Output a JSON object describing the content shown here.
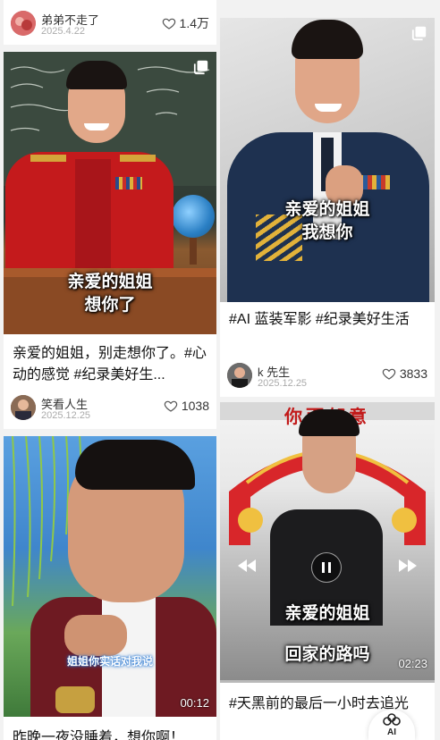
{
  "cards": [
    {
      "username": "弟弟不走了",
      "date": "2025.4.22",
      "likes": "1.4万"
    },
    {
      "subtitle_line1": "亲爱的姐姐",
      "subtitle_line2": "想你了",
      "caption": "亲爱的姐姐，别走想你了。#心动的感觉 #纪录美好生...",
      "username": "笑看人生",
      "date": "2025.12.25",
      "likes": "1038"
    },
    {
      "subtitle_line1": "亲爱的姐姐",
      "subtitle_line2": "我想你",
      "caption": "#AI 蓝装军影 #纪录美好生活",
      "username": "k 先生",
      "date": "2025.12.25",
      "likes": "3833"
    },
    {
      "subtitle": "姐姐你实话对我说",
      "duration": "00:12",
      "caption": "昨晚一夜没睡着，想你啊！"
    },
    {
      "banner": "你而郁意",
      "subtitle_line1": "亲爱的姐姐",
      "subtitle_line2": "回家的路吗",
      "duration": "02:23",
      "caption": "#天黑前的最后一小时去追光"
    }
  ],
  "fab": {
    "label": "AI"
  },
  "colors": {
    "background": "#f2f2f2",
    "red_uniform": "#c41a1c",
    "navy_uniform": "#1e3150",
    "sky": "#4a8fd2"
  }
}
